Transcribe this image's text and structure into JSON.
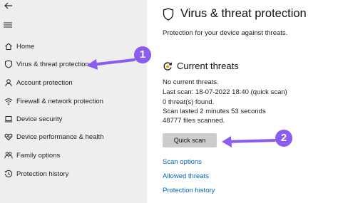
{
  "sidebar": {
    "items": [
      {
        "label": "Home",
        "icon": "home-icon"
      },
      {
        "label": "Virus & threat protection",
        "icon": "shield-icon"
      },
      {
        "label": "Account protection",
        "icon": "person-icon"
      },
      {
        "label": "Firewall & network protection",
        "icon": "wifi-icon"
      },
      {
        "label": "Device security",
        "icon": "laptop-icon"
      },
      {
        "label": "Device performance & health",
        "icon": "heart-icon"
      },
      {
        "label": "Family options",
        "icon": "family-icon"
      },
      {
        "label": "Protection history",
        "icon": "history-icon"
      }
    ]
  },
  "main": {
    "title": "Virus & threat protection",
    "subtitle": "Protection for your device against threats.",
    "current_threats": {
      "heading": "Current threats",
      "lines": [
        "No current threats.",
        "Last scan: 18-07-2022 18:40 (quick scan)",
        "0 threat(s) found.",
        "Scan lasted 2 minutes 53 seconds",
        "48777 files scanned."
      ],
      "quick_scan_label": "Quick scan"
    },
    "links": {
      "scan_options": "Scan options",
      "allowed_threats": "Allowed threats",
      "protection_history": "Protection history"
    }
  },
  "annotations": {
    "badge_1": "1",
    "badge_2": "2",
    "color": "#8a5cf0"
  }
}
